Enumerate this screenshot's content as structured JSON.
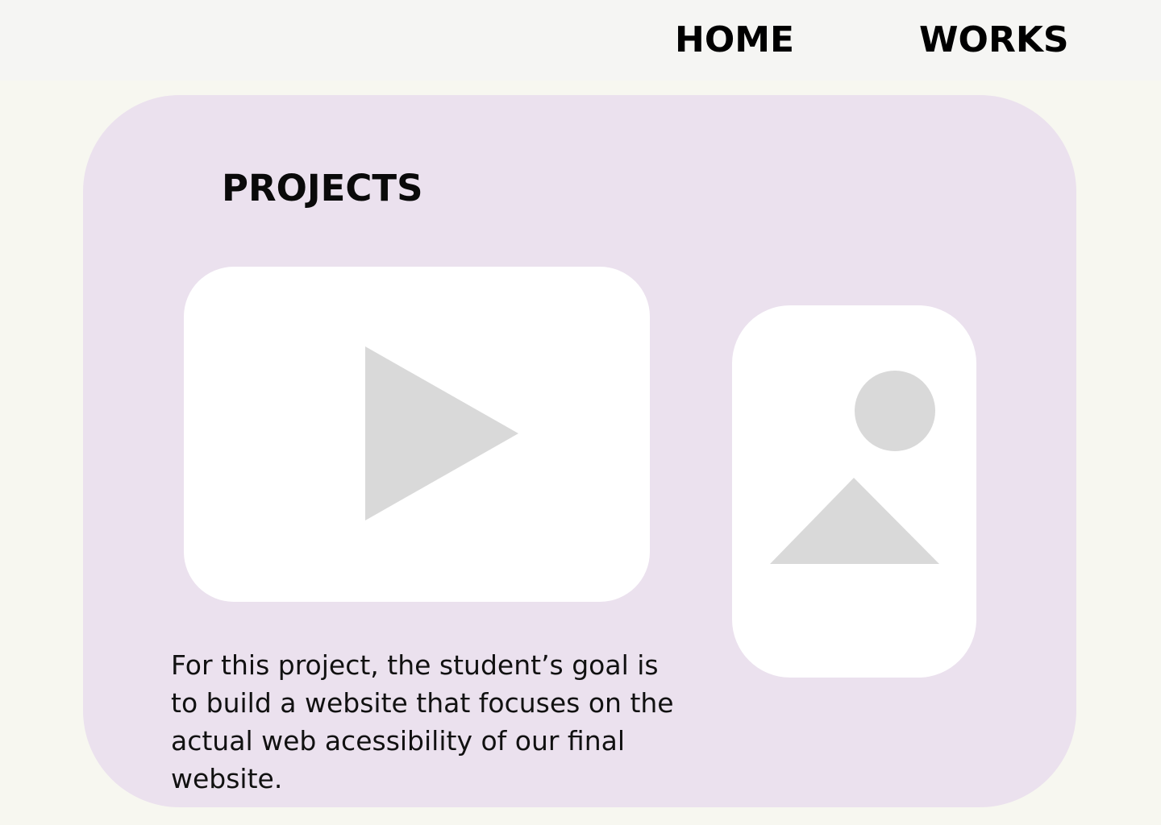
{
  "nav": {
    "home_label": "HOME",
    "works_label": "WORKS"
  },
  "projects": {
    "title": "PROJECTS",
    "video_icon": "play-icon",
    "image_icon": "image-placeholder-icon",
    "description": "For this project, the student’s goal is to build a website that focuses on the actual web acessibility of our final website."
  },
  "colors": {
    "page_background": "#f7f7f0",
    "topbar_background": "#f5f5f3",
    "card_background": "#ebe1ee",
    "placeholder_shape": "#d9d9d9"
  }
}
